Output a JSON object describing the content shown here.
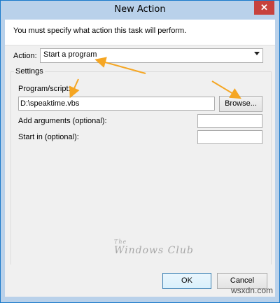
{
  "window": {
    "title": "New Action",
    "close_symbol": "✕"
  },
  "instruction": "You must specify what action this task will perform.",
  "action": {
    "label": "Action:",
    "selected": "Start a program"
  },
  "settings": {
    "title": "Settings",
    "program_label": "Program/script:",
    "program_value": "D:\\speaktime.vbs",
    "browse_label": "Browse...",
    "arguments_label": "Add arguments (optional):",
    "arguments_value": "",
    "start_in_label": "Start in (optional):",
    "start_in_value": ""
  },
  "watermark": {
    "line1_small": "The",
    "line2": "Windows Club"
  },
  "buttons": {
    "ok": "OK",
    "cancel": "Cancel"
  },
  "site_watermark": "wsxdn.com",
  "colors": {
    "arrow": "#f5a623",
    "close_bg": "#c7423d",
    "titlebar_bg": "#b9d1ea"
  }
}
